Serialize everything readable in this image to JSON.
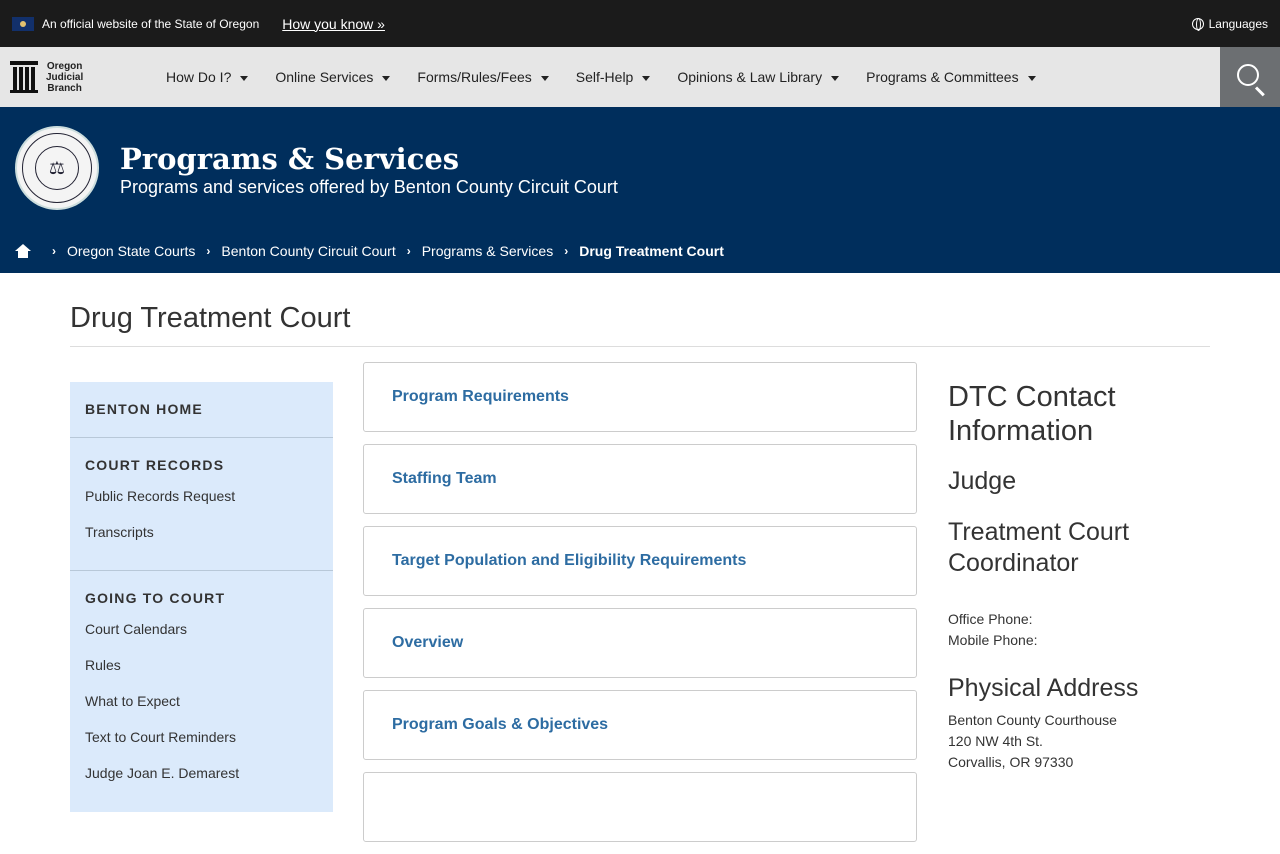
{
  "gov_bar": {
    "official_text": "An official website of the State of Oregon",
    "how_you_know": "How you know »",
    "languages": "Languages"
  },
  "logo": {
    "line1": "Oregon",
    "line2": "Judicial",
    "line3": "Branch"
  },
  "nav": {
    "items": [
      {
        "label": "How Do I?"
      },
      {
        "label": "Online Services"
      },
      {
        "label": "Forms/Rules/Fees"
      },
      {
        "label": "Self-Help"
      },
      {
        "label": "Opinions & Law Library"
      },
      {
        "label": "Programs & Committees"
      }
    ]
  },
  "banner": {
    "title": "Programs & Services",
    "subtitle": "Programs and services offered by Benton County Circuit Court",
    "breadcrumbs": [
      "Oregon State Courts",
      "Benton County Circuit Court",
      "Programs & Services",
      "Drug Treatment Court"
    ]
  },
  "page": {
    "title": "Drug Treatment Court"
  },
  "sidebar": {
    "benton_home": "BENTON HOME",
    "court_records": "COURT RECORDS",
    "court_records_links": [
      "Public Records Request",
      "Transcripts"
    ],
    "going_to_court": "GOING TO COURT",
    "going_to_court_links": [
      "Court Calendars",
      "Rules",
      "What to Expect",
      "Text to Court Reminders",
      "Judge Joan E. Demarest"
    ]
  },
  "cards": [
    "Program Requirements",
    "Staffing Team",
    "Target Population and Eligibility Requirements",
    "Overview",
    "Program Goals & Objectives",
    ""
  ],
  "contact": {
    "heading": "DTC Contact Information",
    "judge": "Judge",
    "coordinator": "Treatment Court Coordinator",
    "office_phone": "Office Phone:",
    "mobile_phone": "Mobile Phone:",
    "address_heading": "Physical Address",
    "address_line1": "Benton County Courthouse",
    "address_line2": "120 NW 4th St.",
    "address_line3": "Corvallis, OR 97330"
  },
  "colors": {
    "banner_bg": "#002e5c",
    "link": "#2d6ca2",
    "sidebar_bg": "#dbeafb"
  }
}
